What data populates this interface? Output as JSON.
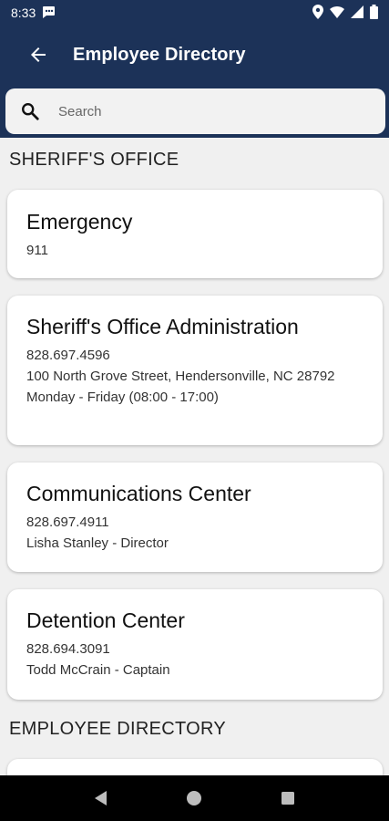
{
  "status_bar": {
    "time": "8:33",
    "icons": [
      "message-icon",
      "location-icon",
      "wifi-icon",
      "signal-icon",
      "battery-icon"
    ]
  },
  "app_bar": {
    "title": "Employee Directory",
    "back_icon": "arrow-left-icon",
    "background_color": "#1c3258"
  },
  "search": {
    "placeholder": "Search",
    "value": ""
  },
  "sections": [
    {
      "header": "SHERIFF'S OFFICE",
      "entries": [
        {
          "title": "Emergency",
          "lines": [
            "911"
          ]
        },
        {
          "title": "Sheriff's Office Administration",
          "lines": [
            "828.697.4596",
            "100 North Grove Street, Hendersonville, NC 28792",
            "Monday - Friday (08:00 - 17:00)"
          ]
        },
        {
          "title": "Communications Center",
          "lines": [
            "828.697.4911",
            "Lisha Stanley - Director"
          ]
        },
        {
          "title": "Detention Center",
          "lines": [
            "828.694.3091",
            "Todd McCrain - Captain"
          ]
        }
      ]
    },
    {
      "header": "EMPLOYEE DIRECTORY",
      "entries": []
    }
  ],
  "nav_bar": {
    "buttons": [
      "back-triangle-icon",
      "home-circle-icon",
      "recents-square-icon"
    ]
  }
}
